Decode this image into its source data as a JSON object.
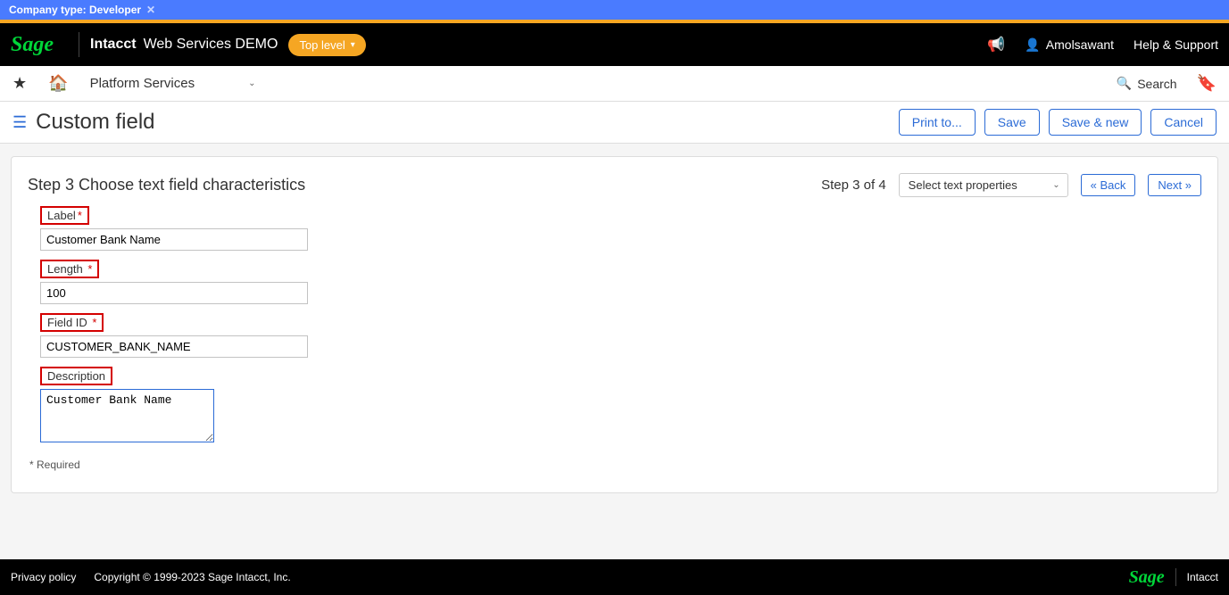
{
  "topbar": {
    "company_type": "Company type: Developer"
  },
  "header": {
    "logo": "Sage",
    "brand": "Intacct",
    "company": "Web Services DEMO",
    "top_level": "Top level",
    "username": "Amolsawant",
    "help": "Help & Support"
  },
  "nav": {
    "module": "Platform Services",
    "search": "Search"
  },
  "page": {
    "title": "Custom field",
    "actions": {
      "print": "Print to...",
      "save": "Save",
      "save_new": "Save & new",
      "cancel": "Cancel"
    }
  },
  "step": {
    "title": "Step 3 Choose text field characteristics",
    "of": "Step 3 of 4",
    "select": "Select text properties",
    "back": "« Back",
    "next": "Next »"
  },
  "form": {
    "label": {
      "label": "Label",
      "value": "Customer Bank Name"
    },
    "length": {
      "label": "Length",
      "value": "100"
    },
    "fieldid": {
      "label": "Field ID",
      "value": "CUSTOMER_BANK_NAME"
    },
    "description": {
      "label": "Description",
      "value": "Customer Bank Name"
    },
    "required_note": "* Required"
  },
  "footer": {
    "privacy": "Privacy policy",
    "copyright": "Copyright © 1999-2023 Sage Intacct, Inc.",
    "logo": "Sage",
    "brand": "Intacct"
  }
}
